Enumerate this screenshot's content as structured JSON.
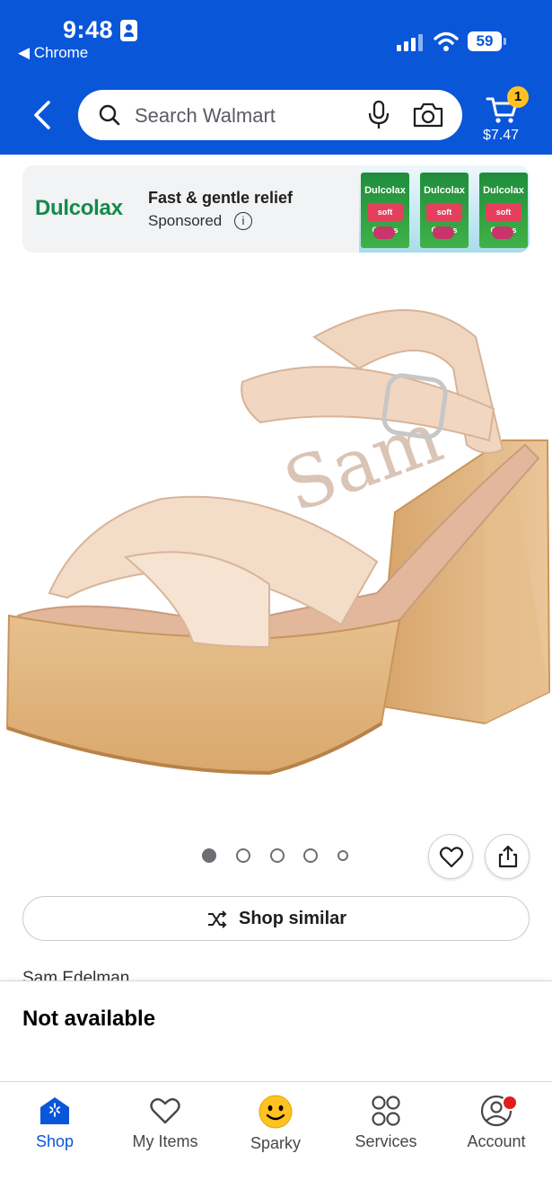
{
  "status_bar": {
    "time": "9:48",
    "back_app": "◀ Chrome",
    "battery": "59"
  },
  "header": {
    "search_placeholder": "Search Walmart",
    "cart_count": "1",
    "cart_total": "$7.47"
  },
  "ad": {
    "brand": "Dulcolax",
    "title": "Fast & gentle relief",
    "sponsored": "Sponsored",
    "info_icon": "i",
    "pack_label": "Dulcolax",
    "pack_sub": "soft Chews"
  },
  "product": {
    "image_count": 5,
    "active_image": 1,
    "shop_similar": "Shop similar",
    "brand": "Sam Edelman",
    "availability": "Not available"
  },
  "nav": {
    "items": [
      {
        "label": "Shop",
        "icon": "home-store-icon",
        "active": true
      },
      {
        "label": "My Items",
        "icon": "heart-icon",
        "active": false
      },
      {
        "label": "Sparky",
        "icon": "smiley-icon",
        "active": false
      },
      {
        "label": "Services",
        "icon": "grid-circles-icon",
        "active": false
      },
      {
        "label": "Account",
        "icon": "account-icon",
        "active": false
      }
    ]
  },
  "colors": {
    "brand_blue": "#0a56d9",
    "spark_yellow": "#ffc220",
    "ad_green": "#148a4a"
  }
}
